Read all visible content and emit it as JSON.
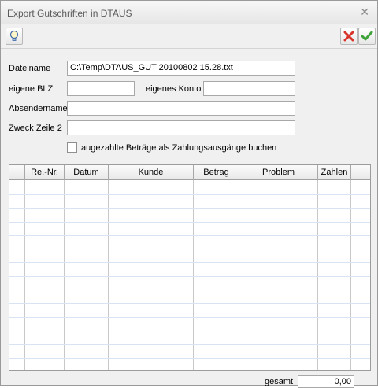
{
  "window": {
    "title": "Export Gutschriften in DTAUS",
    "close_glyph": "✕"
  },
  "toolbar": {
    "left_icon": "lightbulb-icon",
    "cancel_icon": "red-x-icon",
    "ok_icon": "green-check-icon",
    "cancel_color": "#d9342b",
    "ok_color": "#3fa33a"
  },
  "form": {
    "dateiname_label": "Dateiname",
    "dateiname_value": "C:\\Temp\\DTAUS_GUT 20100802 15.28.txt",
    "eigene_blz_label": "eigene BLZ",
    "eigene_blz_value": "",
    "eigenes_konto_label": "eigenes Konto",
    "eigenes_konto_value": "",
    "absendername_label": "Absendername",
    "absendername_value": "",
    "zweck_label": "Zweck Zeile 2",
    "zweck_value": "",
    "checkbox_label": "augezahlte Beträge als Zahlungsausgänge buchen",
    "checkbox_checked": false
  },
  "table": {
    "columns": [
      "Re.-Nr.",
      "Datum",
      "Kunde",
      "Betrag",
      "Problem",
      "Zahlen"
    ]
  },
  "footer": {
    "gesamt_label": "gesamt",
    "gesamt_value": "0,00"
  }
}
